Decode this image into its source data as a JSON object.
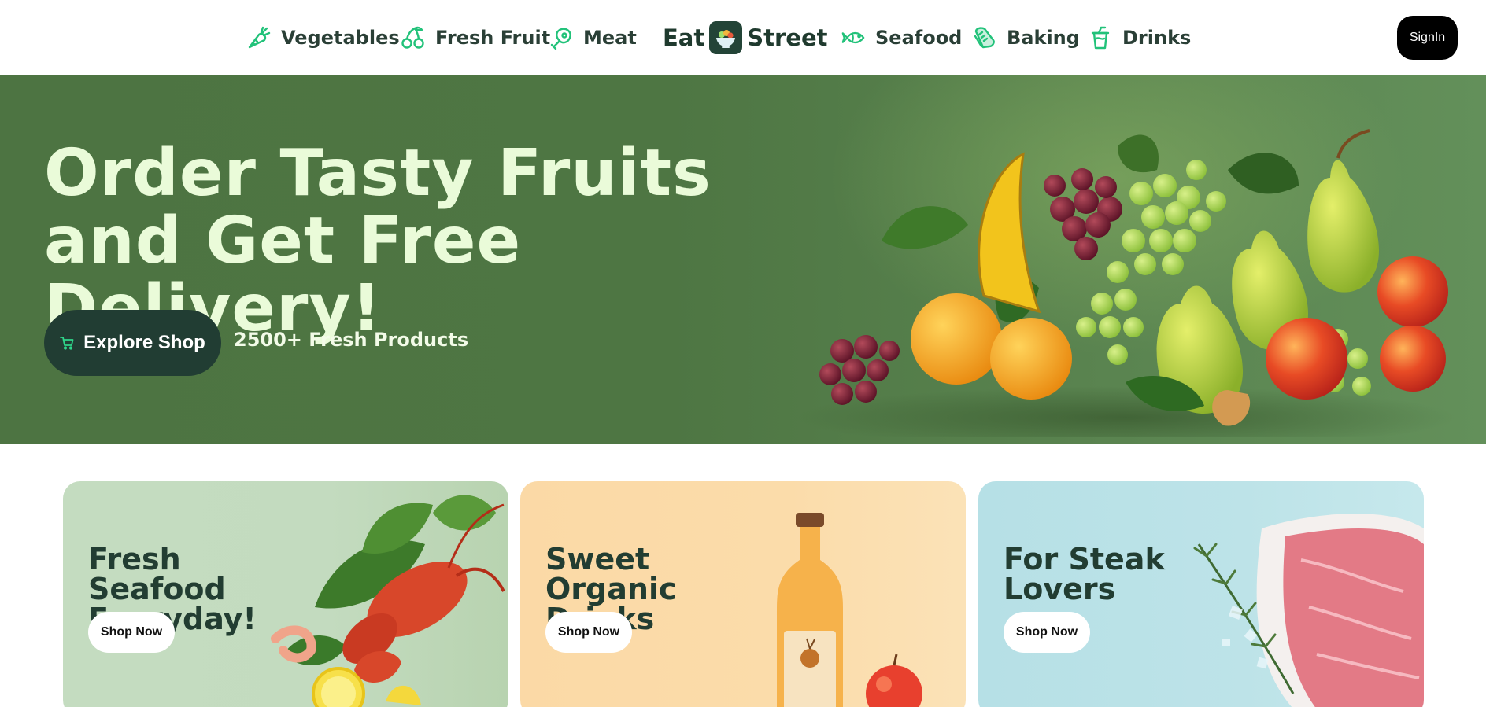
{
  "nav": {
    "left_links": [
      {
        "label": "Vegetables",
        "icon": "carrot-icon"
      },
      {
        "label": "Fresh Fruit",
        "icon": "cherries-icon"
      },
      {
        "label": "Meat",
        "icon": "meat-icon"
      }
    ],
    "logo": {
      "left_text": "Eat",
      "right_text": "Street",
      "icon": "salad-bowl-icon"
    },
    "right_links": [
      {
        "label": "Seafood",
        "icon": "fish-icon"
      },
      {
        "label": "Baking",
        "icon": "bread-icon"
      },
      {
        "label": "Drinks",
        "icon": "cup-icon"
      }
    ],
    "signin_label": "SignIn"
  },
  "hero": {
    "title_line1": "Order Tasty Fruits",
    "title_line2": "and Get Free Delivery!",
    "cta_label": "Explore Shop",
    "cta_icon": "cart-icon",
    "products_text": "2500+ Fresh Products"
  },
  "cards": [
    {
      "title_line1": "Fresh Seafood",
      "title_line2": "Everyday!",
      "button": "Shop Now"
    },
    {
      "title_line1": "Sweet Organic",
      "title_line2": "Drinks",
      "button": "Shop Now"
    },
    {
      "title_line1": "For Steak",
      "title_line2": "Lovers",
      "button": "Shop Now"
    }
  ],
  "colors": {
    "accent_green": "#22c27a",
    "hero_green": "#4e7643",
    "dark_green": "#213d33",
    "hero_text": "#eafbd9"
  }
}
